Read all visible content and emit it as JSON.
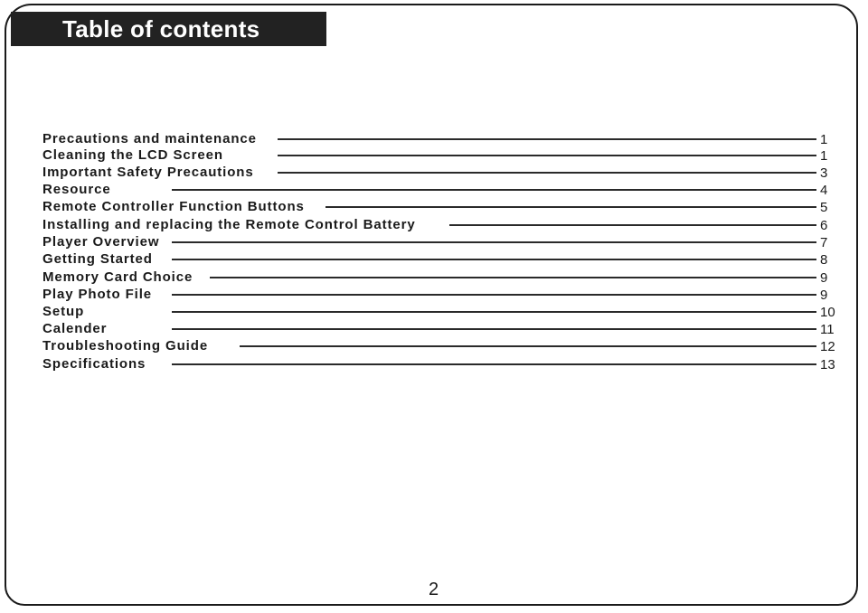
{
  "header": {
    "title": "Table of contents"
  },
  "toc": [
    {
      "label": "Precautions and maintenance",
      "page": "1"
    },
    {
      "label": "Cleaning the LCD Screen",
      "page": "1"
    },
    {
      "label": "Important Safety Precautions",
      "page": "3"
    },
    {
      "label": "Resource",
      "page": "4"
    },
    {
      "label": "Remote Controller Function Buttons",
      "page": "5"
    },
    {
      "label": "Installing and replacing the Remote Control Battery",
      "page": "6"
    },
    {
      "label": "Player Overview",
      "page": "7"
    },
    {
      "label": "Getting Started",
      "page": "8"
    },
    {
      "label": "Memory Card Choice",
      "page": "9"
    },
    {
      "label": "Play Photo File",
      "page": "9"
    },
    {
      "label": "Setup",
      "page": "10"
    },
    {
      "label": "Calender",
      "page": "11"
    },
    {
      "label": "Troubleshooting Guide",
      "page": "12"
    },
    {
      "label": "Specifications",
      "page": "13"
    }
  ],
  "footer": {
    "page_number": "2"
  }
}
